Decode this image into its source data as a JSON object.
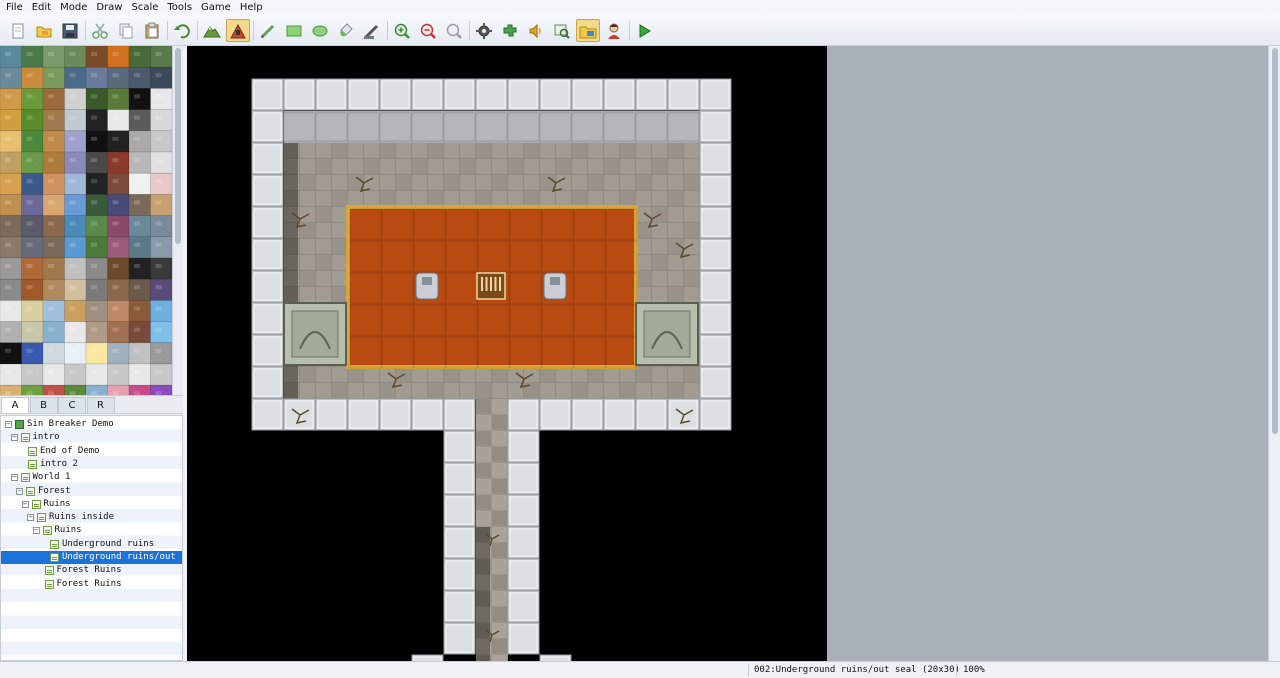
{
  "menu": [
    "File",
    "Edit",
    "Mode",
    "Draw",
    "Scale",
    "Tools",
    "Game",
    "Help"
  ],
  "toolbar": [
    {
      "name": "new-project-icon",
      "active": false
    },
    {
      "name": "open-project-icon",
      "active": false
    },
    {
      "name": "save-project-icon",
      "active": false
    },
    {
      "sep": true
    },
    {
      "name": "cut-icon",
      "active": false
    },
    {
      "name": "copy-icon",
      "active": false
    },
    {
      "name": "paste-icon",
      "active": false
    },
    {
      "sep": true
    },
    {
      "name": "undo-icon",
      "active": false
    },
    {
      "sep": true
    },
    {
      "name": "map-mode-icon",
      "active": false
    },
    {
      "name": "event-mode-icon",
      "active": true
    },
    {
      "sep": true
    },
    {
      "name": "pencil-icon",
      "active": false
    },
    {
      "name": "rectangle-icon",
      "active": false
    },
    {
      "name": "ellipse-icon",
      "active": false
    },
    {
      "name": "flood-fill-icon",
      "active": false
    },
    {
      "name": "shadow-pen-icon",
      "active": false
    },
    {
      "sep": true
    },
    {
      "name": "zoom-in-icon",
      "active": false
    },
    {
      "name": "zoom-out-icon",
      "active": false
    },
    {
      "name": "actual-size-icon",
      "active": false
    },
    {
      "sep": true
    },
    {
      "name": "database-icon",
      "active": false
    },
    {
      "name": "plugin-manager-icon",
      "active": false
    },
    {
      "name": "sound-test-icon",
      "active": false
    },
    {
      "name": "event-search-icon",
      "active": false
    },
    {
      "name": "resource-manager-icon",
      "active": true
    },
    {
      "name": "character-generator-icon",
      "active": false
    },
    {
      "sep": true
    },
    {
      "name": "playtest-icon",
      "active": false
    }
  ],
  "palette_tabs": [
    {
      "label": "A",
      "active": true
    },
    {
      "label": "B",
      "active": false
    },
    {
      "label": "C",
      "active": false
    },
    {
      "label": "R",
      "active": false
    }
  ],
  "tree": [
    {
      "label": "Sin Breaker Demo",
      "depth": 0,
      "expander": "-",
      "root": true
    },
    {
      "label": "intro",
      "depth": 1,
      "expander": "-"
    },
    {
      "label": "End of Demo",
      "depth": 2,
      "expander": null
    },
    {
      "label": "intro 2",
      "depth": 2,
      "expander": null
    },
    {
      "label": "World 1",
      "depth": 1,
      "expander": "-"
    },
    {
      "label": "Forest",
      "depth": 2,
      "expander": "-"
    },
    {
      "label": "Ruins",
      "depth": 3,
      "expander": "-"
    },
    {
      "label": "Ruins inside",
      "depth": 4,
      "expander": "-"
    },
    {
      "label": "Ruins",
      "depth": 5,
      "expander": "-"
    },
    {
      "label": "Underground ruins",
      "depth": 6,
      "expander": null
    },
    {
      "label": "Underground ruins/out seal",
      "depth": 6,
      "expander": null,
      "selected": true
    },
    {
      "label": "Forest Ruins",
      "depth": 5,
      "expander": null
    },
    {
      "label": "Forest Ruins",
      "depth": 5,
      "expander": null
    }
  ],
  "status": {
    "map": "002:Underground ruins/out seal (20x30)",
    "zoom": "100%"
  },
  "colors": {
    "selection": "#1a73d9",
    "carpet": "#b84a12",
    "carpet_border": "#d9a53a",
    "stone_floor": "#8f8a82",
    "wall_block": "#dcdfe2",
    "right_area": "#a9b0ba"
  }
}
